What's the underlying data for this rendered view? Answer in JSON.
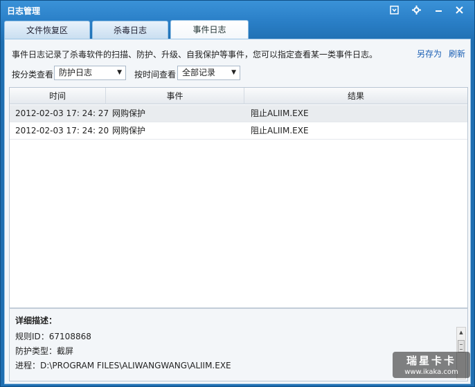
{
  "window": {
    "title": "日志管理"
  },
  "tabs": [
    {
      "label": "文件恢复区"
    },
    {
      "label": "杀毒日志"
    },
    {
      "label": "事件日志",
      "active": true
    }
  ],
  "toolbar": {
    "description": "事件日志记录了杀毒软件的扫描、防护、升级、自我保护等事件，您可以指定查看某一类事件日志。",
    "save_as": "另存为",
    "refresh": "刷新"
  },
  "filters": {
    "category_label": "按分类查看",
    "category_value": "防护日志",
    "time_label": "按时间查看",
    "time_value": "全部记录"
  },
  "grid": {
    "columns": [
      "时间",
      "事件",
      "结果"
    ],
    "rows": [
      {
        "time": "2012-02-03 17: 24: 27",
        "event": "网购保护",
        "result": "阻止ALIIM.EXE",
        "selected": true
      },
      {
        "time": "2012-02-03 17: 24: 20",
        "event": "网购保护",
        "result": "阻止ALIIM.EXE",
        "selected": false
      }
    ]
  },
  "detail": {
    "title": "详细描述：",
    "rule_id": "规则ID：67108868",
    "type": "防护类型：截屏",
    "process": "进程：D:\\PROGRAM FILES\\ALIWANGWANG\\ALIIM.EXE"
  },
  "watermark": {
    "line1": "瑞星卡卡",
    "line2": "www.ikaka.com"
  },
  "colors": {
    "title_bar": "#2a7fc7",
    "link": "#1a5fb4",
    "selected_row": "#e9ecef"
  },
  "icons": [
    "minimize-to-tray-icon",
    "gear-icon",
    "minimize-icon",
    "close-icon",
    "dropdown-arrow-icon"
  ]
}
